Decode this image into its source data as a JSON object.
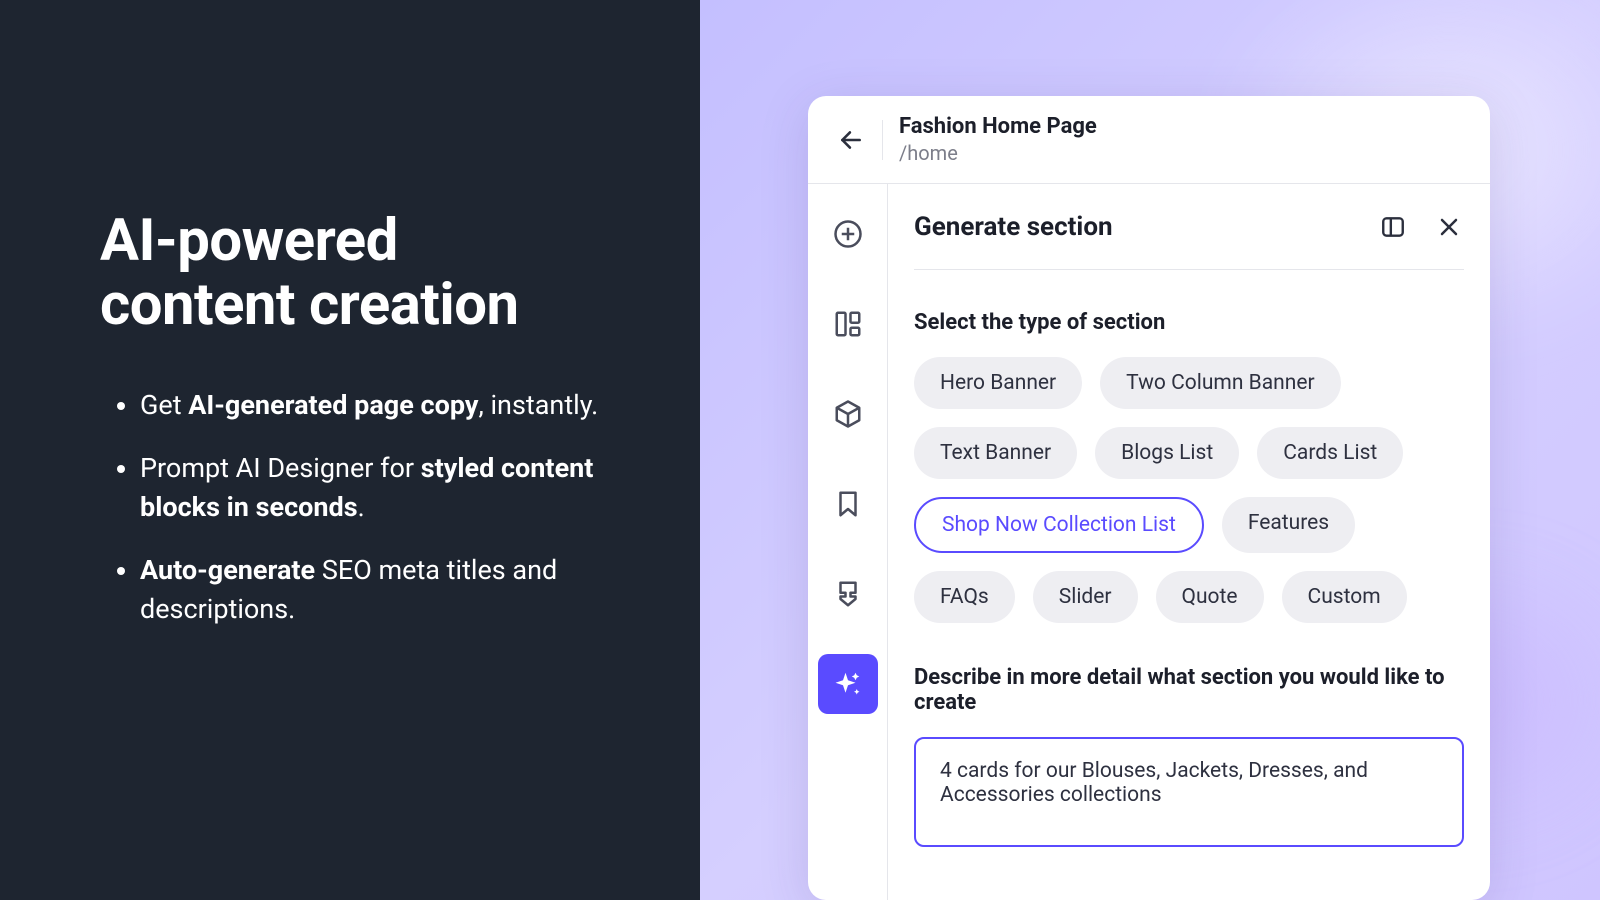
{
  "marketing": {
    "headline_line1": "AI-powered",
    "headline_line2": "content creation",
    "bullet1_pre": "Get ",
    "bullet1_bold": "AI-generated page copy",
    "bullet1_post": ", instantly.",
    "bullet2_pre": "Prompt AI Designer for ",
    "bullet2_bold": "styled content blocks in seconds",
    "bullet2_post": ".",
    "bullet3_bold": "Auto-generate",
    "bullet3_post": " SEO meta titles and descriptions."
  },
  "colors": {
    "accent": "#5a4bff",
    "dark_bg": "#1e2530"
  },
  "app": {
    "page_title": "Fashion Home Page",
    "page_path": "/home",
    "panel_title": "Generate section",
    "select_label": "Select the type of section",
    "describe_label": "Describe in more detail what section you would like to create",
    "describe_value": "4 cards for our Blouses, Jackets, Dresses, and Accessories collections",
    "section_types": [
      {
        "label": "Hero Banner",
        "selected": false
      },
      {
        "label": "Two Column Banner",
        "selected": false
      },
      {
        "label": "Text Banner",
        "selected": false
      },
      {
        "label": "Blogs List",
        "selected": false
      },
      {
        "label": "Cards List",
        "selected": false
      },
      {
        "label": "Shop Now Collection List",
        "selected": true
      },
      {
        "label": "Features",
        "selected": false
      },
      {
        "label": "FAQs",
        "selected": false
      },
      {
        "label": "Slider",
        "selected": false
      },
      {
        "label": "Quote",
        "selected": false
      },
      {
        "label": "Custom",
        "selected": false
      }
    ],
    "sidebar": [
      {
        "name": "add"
      },
      {
        "name": "layout"
      },
      {
        "name": "cube"
      },
      {
        "name": "bookmark"
      },
      {
        "name": "brush"
      },
      {
        "name": "sparkle"
      }
    ],
    "active_sidebar": "sparkle"
  }
}
